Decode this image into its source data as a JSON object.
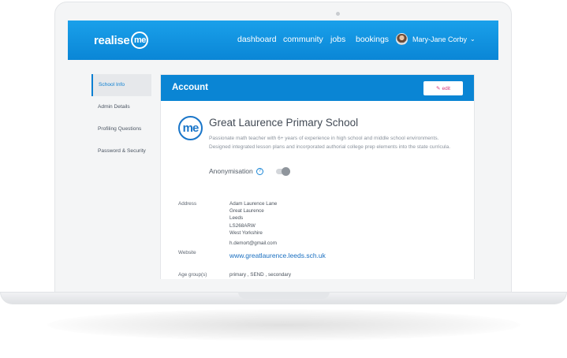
{
  "brand": {
    "logo_word": "realise",
    "logo_badge": "me"
  },
  "nav": {
    "dashboard": "dashboard",
    "community": "community",
    "jobs": "jobs",
    "bookings": "bookings"
  },
  "user": {
    "name": "Mary-Jane Corby"
  },
  "sidebar": {
    "items": [
      {
        "label": "School Info"
      },
      {
        "label": "Admin Details"
      },
      {
        "label": "Profiling Questions"
      },
      {
        "label": "Password & Security"
      }
    ]
  },
  "account": {
    "title": "Account",
    "edit_label": "edit",
    "school_name": "Great Laurence Primary School",
    "about": "Passionate math teacher with 6+ years of experience in high school and middle school environments. Designed integrated lesson plans and incorporated authorial college prep elements into the state curricula.",
    "anonymisation_label": "Anonymisation",
    "anonymisation_enabled": false,
    "address_label": "Address",
    "address_lines": [
      "Adam Laurence Lane",
      "Great Laurence",
      "Leeds",
      "LS268ARW",
      "West Yorkshire"
    ],
    "email": "h.demort@gmail.com",
    "website_label": "Website",
    "website": "www.greatlaurence.leeds.sch.uk",
    "age_groups_label": "Age group(s)",
    "age_groups": "primary ,  SEND ,  secondary"
  },
  "colors": {
    "header_blue": "#0a86d6",
    "link_blue": "#1a6fc0",
    "edit_pink": "#d6337b"
  },
  "icons": {
    "edit": "pencil-icon",
    "help": "question-circle-icon",
    "user_menu": "chevron-down-icon"
  }
}
